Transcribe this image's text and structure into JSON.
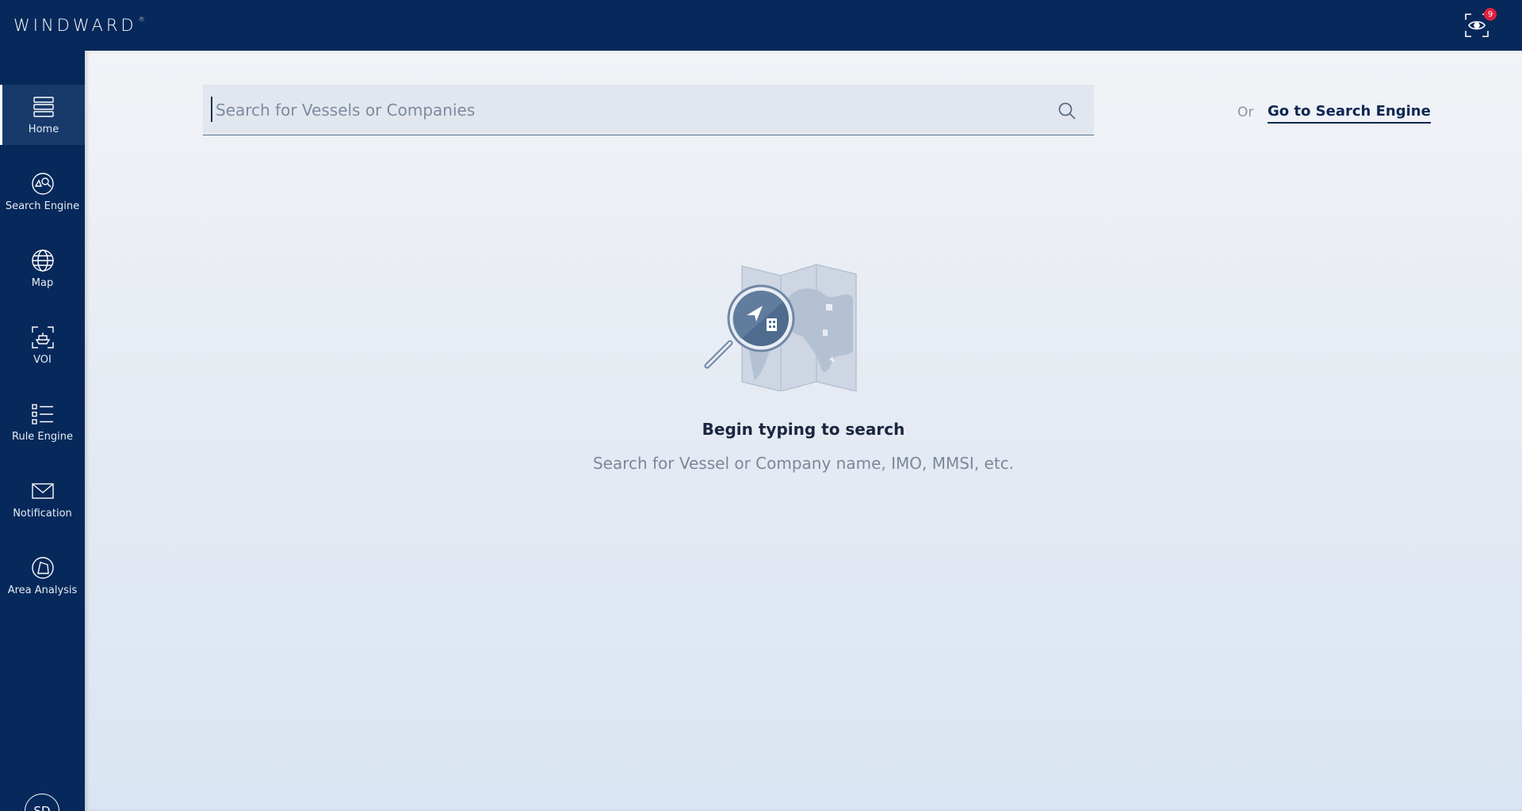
{
  "header": {
    "logo": "WINDWARD",
    "logo_mark": "®",
    "voi_icon": "eye-scan-icon",
    "voi_badge_count": "9"
  },
  "sidebar": {
    "items": [
      {
        "label": "Home",
        "icon": "home-list-icon",
        "active": true
      },
      {
        "label": "Search Engine",
        "icon": "search-engine-icon",
        "active": false
      },
      {
        "label": "Map",
        "icon": "globe-icon",
        "active": false
      },
      {
        "label": "VOI",
        "icon": "voi-ship-icon",
        "active": false
      },
      {
        "label": "Rule Engine",
        "icon": "rule-list-icon",
        "active": false
      },
      {
        "label": "Notification",
        "icon": "envelope-icon",
        "active": false
      },
      {
        "label": "Area Analysis",
        "icon": "area-polygon-icon",
        "active": false
      }
    ],
    "user_initials": "SD"
  },
  "search": {
    "placeholder": "Search for Vessels or Companies",
    "value": "",
    "icon": "search-icon"
  },
  "alt_action": {
    "or_text": "Or",
    "link_label": "Go to Search Engine"
  },
  "empty_state": {
    "illustration": "map-magnifier-illustration",
    "title": "Begin typing to search",
    "subtitle": "Search for Vessel or Company name, IMO, MMSI, etc."
  },
  "colors": {
    "nav_bg": "#06285a",
    "nav_active_bg": "#173a6b",
    "badge": "#e0223e",
    "link": "#0e2752"
  }
}
